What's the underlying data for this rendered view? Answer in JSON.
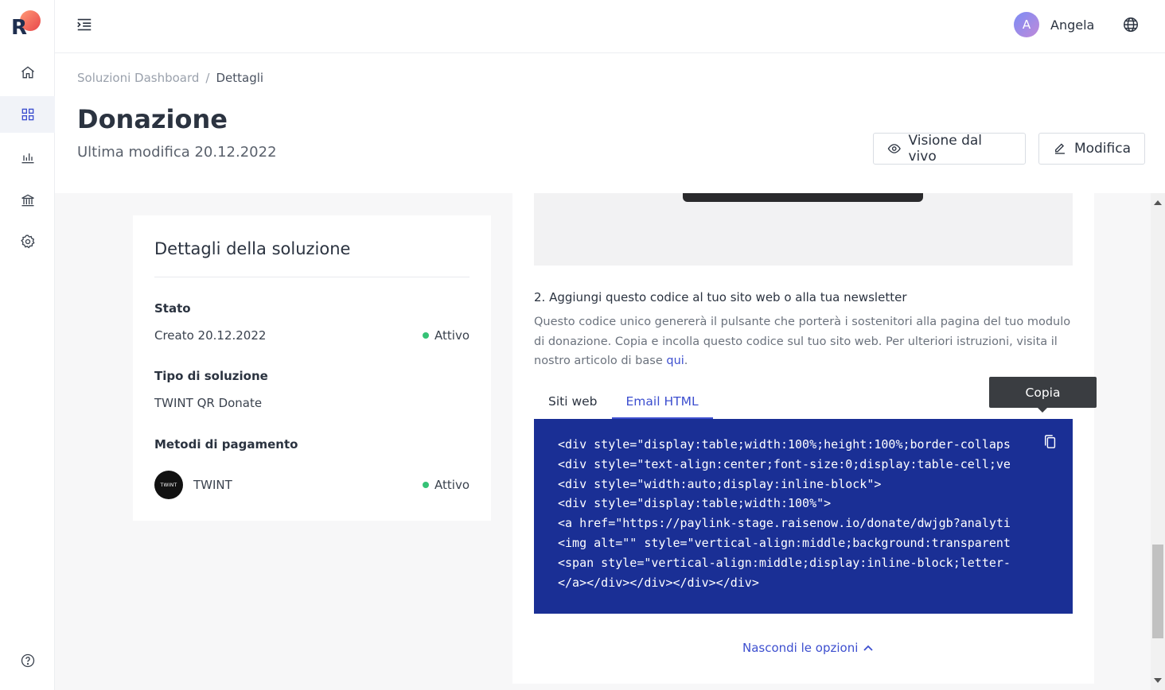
{
  "app": {
    "logo_letter": "R"
  },
  "sidebar": {
    "items": [
      {
        "icon": "home-icon"
      },
      {
        "icon": "grid-icon",
        "active": true
      },
      {
        "icon": "bar-chart-icon"
      },
      {
        "icon": "bank-icon"
      },
      {
        "icon": "gear-icon"
      },
      {
        "icon": "help-icon"
      }
    ]
  },
  "header": {
    "user": {
      "initial": "A",
      "name": "Angela"
    }
  },
  "page": {
    "breadcrumb": {
      "parent": "Soluzioni Dashboard",
      "separator": "/",
      "current": "Dettagli"
    },
    "title": "Donazione",
    "subtitle": "Ultima modifica 20.12.2022",
    "buttons": {
      "live_view": "Visione dal vivo",
      "edit": "Modifica"
    }
  },
  "details": {
    "title": "Dettagli della soluzione",
    "state_label": "Stato",
    "created": "Creato 20.12.2022",
    "state_value": "Attivo",
    "type_label": "Tipo di soluzione",
    "type_value": "TWINT QR Donate",
    "payment_label": "Metodi di pagamento",
    "payment_logo_text": "TWINT",
    "payment_name": "TWINT",
    "payment_status": "Attivo"
  },
  "embed": {
    "step_title": "2. Aggiungi questo codice al tuo sito web o alla tua newsletter",
    "description": "Questo codice unico genererà il pulsante che porterà i sostenitori alla pagina del tuo modulo di donazione. Copia e incolla questo codice sul tuo sito web. Per ulteriori istruzioni, visita il nostro articolo di base ",
    "description_link": "qui",
    "description_end": ".",
    "tabs": [
      "Siti web",
      "Email HTML"
    ],
    "active_tab": 1,
    "code_lines": [
      "<div style=\"display:table;width:100%;height:100%;border-collaps",
      "<div style=\"text-align:center;font-size:0;display:table-cell;ve",
      "<div style=\"width:auto;display:inline-block\">",
      "<div style=\"display:table;width:100%\">",
      "<a href=\"https://paylink-stage.raisenow.io/donate/dwjgb?analyti",
      "<img alt=\"\" style=\"vertical-align:middle;background:transparent",
      "<span style=\"vertical-align:middle;display:inline-block;letter-",
      "</a></div></div></div></div>"
    ],
    "tooltip": "Copia",
    "hide_options": "Nascondi le opzioni"
  },
  "colors": {
    "accent": "#3d4fcf",
    "code_bg": "#1a2f95",
    "status_green": "#35c276"
  }
}
